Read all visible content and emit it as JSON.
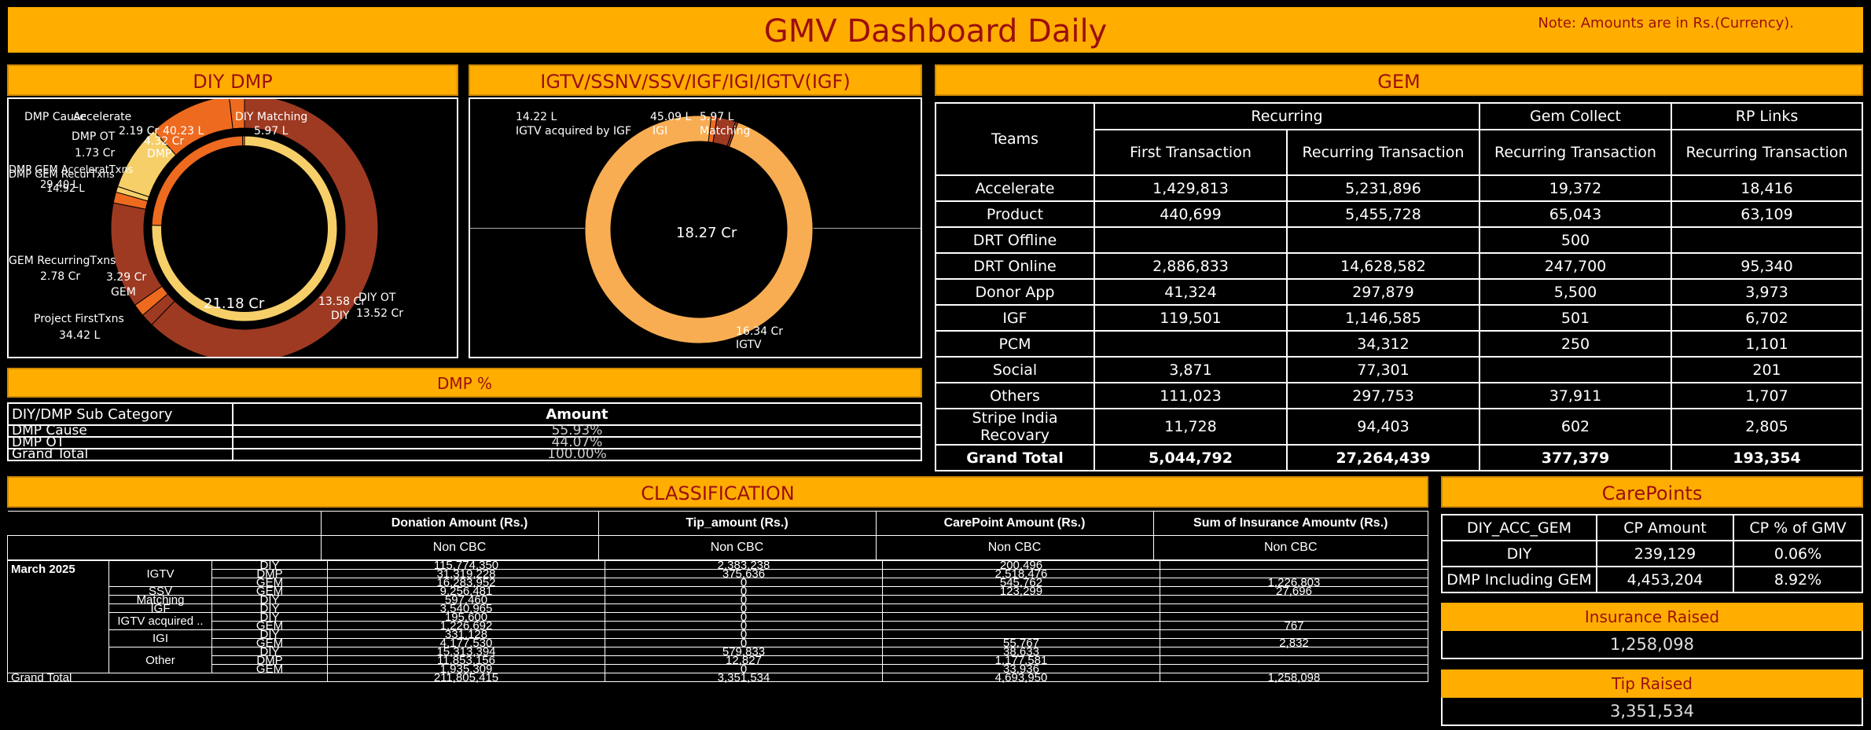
{
  "header": {
    "title": "GMV Dashboard Daily",
    "note": "Note: Amounts are in Rs.(Currency)."
  },
  "colors": {
    "header_bg": "#ffae00",
    "header_text": "#9b0e0e",
    "donut_dark": "#9e3a22",
    "donut_orange": "#ee6a1f",
    "donut_light": "#f7cf69",
    "donut_peach": "#f8ad52"
  },
  "diy_dmp": {
    "title": "DIY DMP",
    "outer_labels": [
      "DMP Cause",
      "Accelerate",
      "2.19 Cr",
      "40.23 L",
      "4.32 Cr",
      "DMP",
      "DMP OT",
      "1.73 Cr",
      "DMP GEM AcceleratTxns",
      "DMP GEM RecurTxns",
      "29.40 L",
      "14.92 L",
      "GEM RecurringTxns",
      "2.78 Cr",
      "3.29 Cr",
      "GEM",
      "Project FirstTxns",
      "34.42 L",
      "13.58 Cr",
      "DIY",
      "DIY OT",
      "13.52 Cr"
    ],
    "inner_labels": [
      "DIY Matching",
      "5.97 L",
      "21.18 Cr"
    ]
  },
  "igtv": {
    "title": "IGTV/SSNV/SSV/IGF/IGI/IGTV(IGF)",
    "center": "18.27 Cr",
    "labels": [
      "14.22 L",
      "IGTV acquired by IGF",
      "45.09 L",
      "IGI",
      "5.97 L",
      "Matching",
      "16.34 Cr",
      "IGTV"
    ]
  },
  "dmp_pct": {
    "title": "DMP %",
    "headers": [
      "DIY/DMP Sub Category",
      "Amount"
    ],
    "rows": [
      [
        "DMP Cause",
        "55.93%"
      ],
      [
        "DMP OT",
        "44.07%"
      ],
      [
        "Grand Total",
        "100.00%"
      ]
    ]
  },
  "gem": {
    "title": "GEM",
    "groups": [
      "Recurring",
      "Gem Collect",
      "RP Links"
    ],
    "teams_header": "Teams",
    "subheaders": [
      "First Transaction",
      "Recurring Transaction",
      "Recurring Transaction",
      "Recurring Transaction"
    ],
    "rows": [
      [
        "Accelerate",
        "1,429,813",
        "5,231,896",
        "19,372",
        "18,416"
      ],
      [
        "Product",
        "440,699",
        "5,455,728",
        "65,043",
        "63,109"
      ],
      [
        "DRT Offline",
        "",
        "",
        "500",
        ""
      ],
      [
        "DRT Online",
        "2,886,833",
        "14,628,582",
        "247,700",
        "95,340"
      ],
      [
        "Donor App",
        "41,324",
        "297,879",
        "5,500",
        "3,973"
      ],
      [
        "IGF",
        "119,501",
        "1,146,585",
        "501",
        "6,702"
      ],
      [
        "PCM",
        "",
        "34,312",
        "250",
        "1,101"
      ],
      [
        "Social",
        "3,871",
        "77,301",
        "",
        "201"
      ],
      [
        "Others",
        "111,023",
        "297,753",
        "37,911",
        "1,707"
      ],
      [
        "Stripe India Recovary",
        "11,728",
        "94,403",
        "602",
        "2,805"
      ],
      [
        "Grand Total",
        "5,044,792",
        "27,264,439",
        "377,379",
        "193,354"
      ]
    ]
  },
  "classification": {
    "title": "CLASSIFICATION",
    "headers": [
      "Donation Amount (Rs.)",
      "Tip_amount (Rs.)",
      "CarePoint Amount (Rs.)",
      "Sum of Insurance Amountv (Rs.)"
    ],
    "subheader": "Non CBC",
    "month": "March 2025",
    "rows": [
      [
        "IGTV",
        "DIY",
        "115,774,350",
        "2,383,238",
        "200,496",
        ""
      ],
      [
        "",
        "DMP",
        "31,319,228",
        "375,636",
        "2,518,476",
        ""
      ],
      [
        "",
        "GEM",
        "16,283,952",
        "0",
        "545,762",
        "1,226,803"
      ],
      [
        "SSV",
        "GEM",
        "9,256,481",
        "0",
        "123,299",
        "27,696"
      ],
      [
        "Matching",
        "DIY",
        "597,460",
        "0",
        "",
        ""
      ],
      [
        "IGF",
        "DIY",
        "3,540,965",
        "0",
        "",
        ""
      ],
      [
        "IGTV acquired ..",
        "DIY",
        "195,600",
        "0",
        "",
        ""
      ],
      [
        "",
        "GEM",
        "1,226,692",
        "0",
        "",
        "767"
      ],
      [
        "IGI",
        "DIY",
        "331,128",
        "0",
        "",
        ""
      ],
      [
        "",
        "GEM",
        "4,177,530",
        "0",
        "55,767",
        "2,832"
      ],
      [
        "Other",
        "DIY",
        "15,313,394",
        "579,833",
        "38,633",
        ""
      ],
      [
        "",
        "DMP",
        "11,853,156",
        "12,827",
        "1,177,581",
        ""
      ],
      [
        "",
        "GEM",
        "1,935,309",
        "0",
        "33,936",
        ""
      ]
    ],
    "grand_total": [
      "Grand Total",
      "211,805,415",
      "3,351,534",
      "4,693,950",
      "1,258,098"
    ]
  },
  "carepoints": {
    "title": "CarePoints",
    "headers": [
      "DIY_ACC_GEM",
      "CP Amount",
      "CP % of GMV"
    ],
    "rows": [
      [
        "DIY",
        "239,129",
        "0.06%"
      ],
      [
        "DMP Including GEM",
        "4,453,204",
        "8.92%"
      ]
    ]
  },
  "insurance": {
    "title": "Insurance Raised",
    "value": "1,258,098"
  },
  "tip": {
    "title": "Tip Raised",
    "value": "3,351,534"
  },
  "chart_data": [
    {
      "type": "pie",
      "title": "DIY DMP",
      "ring": "outer",
      "categories": [
        "DIY OT",
        "Project FirstTxns",
        "GEM",
        "GEM RecurringTxns",
        "DMP GEM RecurTxns",
        "DMP GEM AcceleratTxns",
        "DMP OT",
        "DMP Cause",
        "DMP Accelerate"
      ],
      "values": [
        13.52,
        0.34,
        0.33,
        2.78,
        0.29,
        0.15,
        1.73,
        2.19,
        0.4
      ],
      "units": "Cr"
    },
    {
      "type": "pie",
      "title": "DIY DMP",
      "ring": "inner",
      "categories": [
        "DIY",
        "DMP",
        "DIY Matching"
      ],
      "values": [
        13.58,
        4.32,
        0.06
      ],
      "total": "21.18 Cr",
      "units": "Cr"
    },
    {
      "type": "pie",
      "title": "IGTV/SSNV/SSV/IGF/IGI/IGTV(IGF)",
      "categories": [
        "IGTV",
        "IGTV acquired by IGF",
        "IGI",
        "Matching"
      ],
      "values": [
        16.34,
        0.1422,
        0.4509,
        0.0597
      ],
      "total": "18.27 Cr",
      "units": "Cr"
    }
  ]
}
